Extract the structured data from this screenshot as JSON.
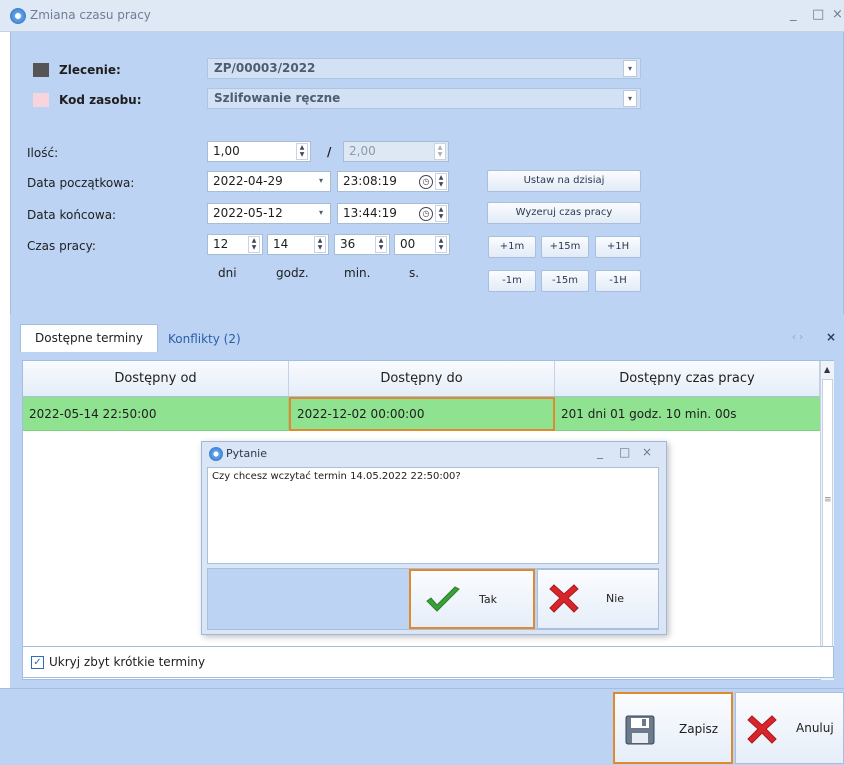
{
  "window": {
    "title": "Zmiana czasu pracy",
    "controls": [
      "_",
      "□",
      "×"
    ]
  },
  "form": {
    "zlecenie_label": "Zlecenie:",
    "zlecenie_value": "ZP/00003/2022",
    "kod_label": "Kod zasobu:",
    "kod_value": "Szlifowanie ręczne",
    "ilosc_label": "Ilość:",
    "ilosc_value": "1,00",
    "ilosc_sep": "/",
    "ilosc_max": "2,00",
    "start_label": "Data początkowa:",
    "start_date": "2022-04-29",
    "start_time": "23:08:19",
    "end_label": "Data końcowa:",
    "end_date": "2022-05-12",
    "end_time": "13:44:19",
    "czas_label": "Czas pracy:",
    "czas_dni": "12",
    "czas_godz": "14",
    "czas_min": "36",
    "czas_s": "00",
    "unit_dni": "dni",
    "unit_godz": "godz.",
    "unit_min": "min.",
    "unit_s": "s.",
    "btn_ustaw": "Ustaw na dzisiaj",
    "btn_wyzeruj": "Wyzeruj czas pracy",
    "btn_p1m": "+1m",
    "btn_p15m": "+15m",
    "btn_p1h": "+1H",
    "btn_m1m": "-1m",
    "btn_m15m": "-15m",
    "btn_m1h": "-1H"
  },
  "tabs": {
    "tab1": "Dostępne terminy",
    "tab2": "Konflikty (2)",
    "close": "×",
    "nav": "‹ ›"
  },
  "grid": {
    "col1": "Dostępny od",
    "col2": "Dostępny do",
    "col3": "Dostępny czas pracy",
    "row1": {
      "od": "2022-05-14 22:50:00",
      "do": "2022-12-02 00:00:00",
      "czas": "201 dni 01 godz. 10 min. 00s"
    },
    "checkbox_label": "Ukryj zbyt krótkie terminy"
  },
  "dialog": {
    "title": "Pytanie",
    "message": "Czy chcesz wczytać termin 14.05.2022 22:50:00?",
    "yes": "Tak",
    "no": "Nie",
    "controls": [
      "_",
      "□",
      "×"
    ]
  },
  "footer": {
    "save": "Zapisz",
    "cancel": "Anuluj"
  },
  "colors": {
    "accent": "#bcd3f3",
    "row_green": "#8fe28f",
    "focus_orange": "#e08a2e"
  }
}
